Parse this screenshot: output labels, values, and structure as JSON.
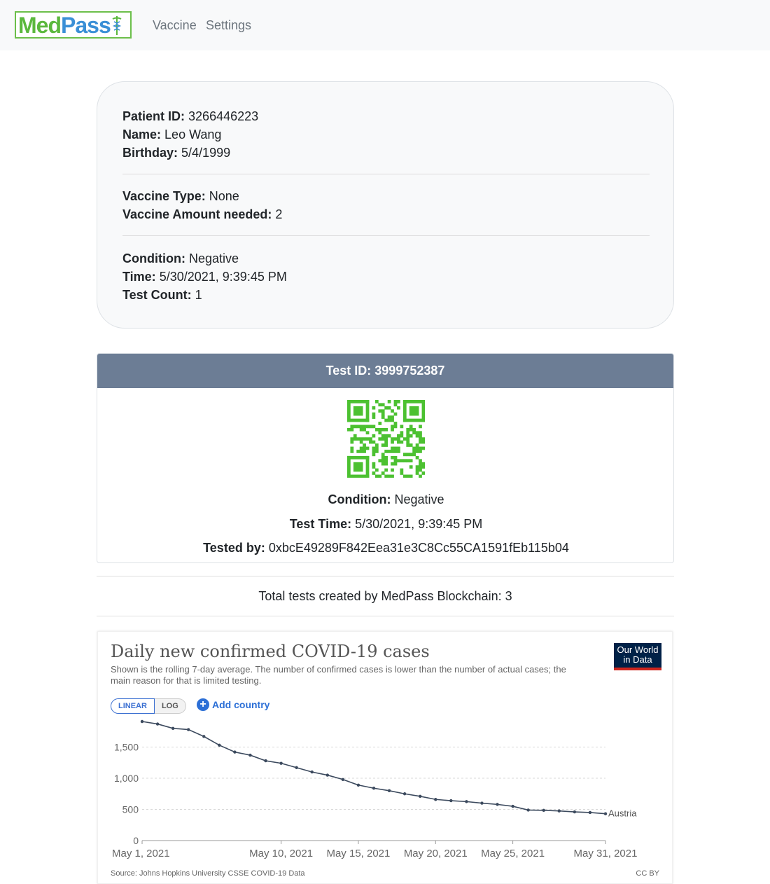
{
  "navbar": {
    "logo_text": "MedPass",
    "logo_part_med": "Med",
    "logo_part_pass": "Pass",
    "links": [
      "Vaccine",
      "Settings"
    ]
  },
  "patient": {
    "id_label": "Patient ID:",
    "id": "3266446223",
    "name_label": "Name:",
    "name": "Leo Wang",
    "birthday_label": "Birthday:",
    "birthday": "5/4/1999",
    "vaccine_type_label": "Vaccine Type:",
    "vaccine_type": "None",
    "vaccine_amount_label": "Vaccine Amount needed:",
    "vaccine_amount": "2",
    "condition_label": "Condition:",
    "condition": "Negative",
    "time_label": "Time:",
    "time": "5/30/2021, 9:39:45 PM",
    "test_count_label": "Test Count:",
    "test_count": "1"
  },
  "test": {
    "header": "Test ID: 3999752387",
    "condition_label": "Condition:",
    "condition": "Negative",
    "time_label": "Test Time:",
    "time": "5/30/2021, 9:39:45 PM",
    "tested_by_label": "Tested by:",
    "tested_by": "0xbcE49289F842Eea31e3C8Cc55CA1591fEb115b04",
    "qr_color": "#4cc131"
  },
  "total_tests": "Total tests created by MedPass Blockchain: 3",
  "owid": {
    "title": "Daily new confirmed COVID-19 cases",
    "subtitle": "Shown is the rolling 7-day average. The number of confirmed cases is lower than the number of actual cases; the main reason for that is limited testing.",
    "logo_line1": "Our World",
    "logo_line2": "in Data",
    "scale_linear": "LINEAR",
    "scale_log": "LOG",
    "add_country": "Add country",
    "source": "Source: Johns Hopkins University CSSE COVID-19 Data",
    "license": "CC BY"
  },
  "chart_data": {
    "type": "line",
    "x": [
      "May 1, 2021",
      "May 2, 2021",
      "May 3, 2021",
      "May 4, 2021",
      "May 5, 2021",
      "May 6, 2021",
      "May 7, 2021",
      "May 8, 2021",
      "May 9, 2021",
      "May 10, 2021",
      "May 11, 2021",
      "May 12, 2021",
      "May 13, 2021",
      "May 14, 2021",
      "May 15, 2021",
      "May 16, 2021",
      "May 17, 2021",
      "May 18, 2021",
      "May 19, 2021",
      "May 20, 2021",
      "May 21, 2021",
      "May 22, 2021",
      "May 23, 2021",
      "May 24, 2021",
      "May 25, 2021",
      "May 26, 2021",
      "May 27, 2021",
      "May 28, 2021",
      "May 29, 2021",
      "May 30, 2021",
      "May 31, 2021"
    ],
    "series": [
      {
        "name": "Austria",
        "values": [
          1910,
          1870,
          1800,
          1780,
          1670,
          1530,
          1420,
          1370,
          1280,
          1240,
          1170,
          1100,
          1050,
          980,
          890,
          840,
          800,
          750,
          710,
          660,
          640,
          625,
          600,
          580,
          550,
          490,
          485,
          475,
          460,
          450,
          430
        ]
      }
    ],
    "x_ticks": [
      "May 1, 2021",
      "May 10, 2021",
      "May 15, 2021",
      "May 20, 2021",
      "May 25, 2021",
      "May 31, 2021"
    ],
    "y_ticks": [
      "0",
      "500",
      "1,000",
      "1,500"
    ],
    "ylim": [
      0,
      2000
    ],
    "line_color": "#3c4a5e",
    "grid": true
  }
}
